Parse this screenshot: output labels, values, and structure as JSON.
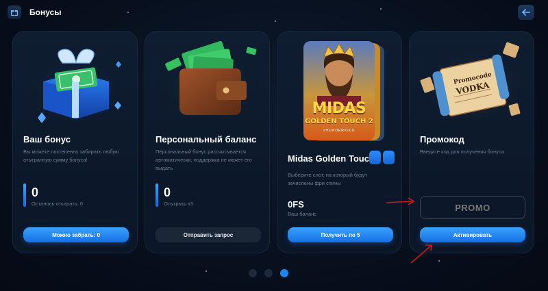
{
  "header": {
    "title": "Бонусы"
  },
  "cards": [
    {
      "title": "Ваш бонус",
      "description": "Вы можете постепенно забирать любую отыгранную сумму бонуса!",
      "value": "0",
      "value_sub": "Осталось отыграть: 0",
      "button": "Можно забрать: 0"
    },
    {
      "title": "Персональный баланс",
      "description": "Персональный бонус рассчитывается автоматически, поддержка не может его выдать",
      "value": "0",
      "value_sub": "Отыгрыш x3",
      "button": "Отправить запрос"
    },
    {
      "title": "Midas Golden Touc…",
      "description": "Выберите слот, на который будут зачислены фри спины",
      "value": "0FS",
      "value_sub": "Ваш баланс",
      "button": "Получить по 5",
      "slot_line1": "MIDAS",
      "slot_line2": "GOLDEN TOUCH 2",
      "slot_line3": "THUNDERKICK"
    },
    {
      "title": "Промокод",
      "description": "Введите код для получения бонуса",
      "placeholder": "PROMO",
      "button": "Активировать",
      "scroll_line1": "Promocode",
      "scroll_line2": "VODKA"
    }
  ],
  "pager": {
    "count": 3,
    "active": 3
  },
  "colors": {
    "accent": "#1e86f0",
    "card_bg": "#0f1d31",
    "page_bg": "#070e1b",
    "annotation": "#d11a1a"
  }
}
